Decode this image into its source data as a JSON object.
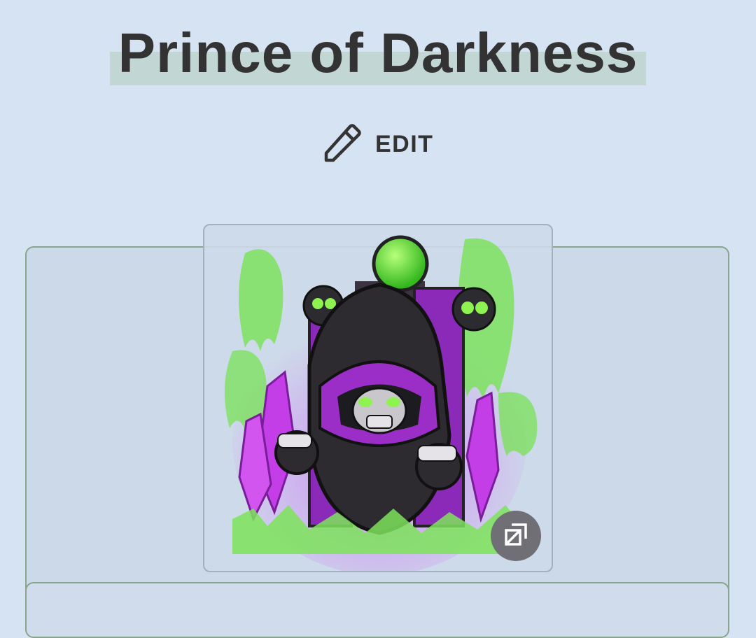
{
  "page": {
    "title": "Prince of Darkness",
    "edit_label": "EDIT"
  },
  "icons": {
    "edit": "pencil-icon",
    "expand": "expand-image-icon"
  },
  "colors": {
    "background": "#d6e3f3",
    "title_highlight": "#c2d6d3",
    "panel_border": "#8aa58a",
    "ghost_green": "#6fe24a",
    "robe_purple": "#b02bd4"
  }
}
